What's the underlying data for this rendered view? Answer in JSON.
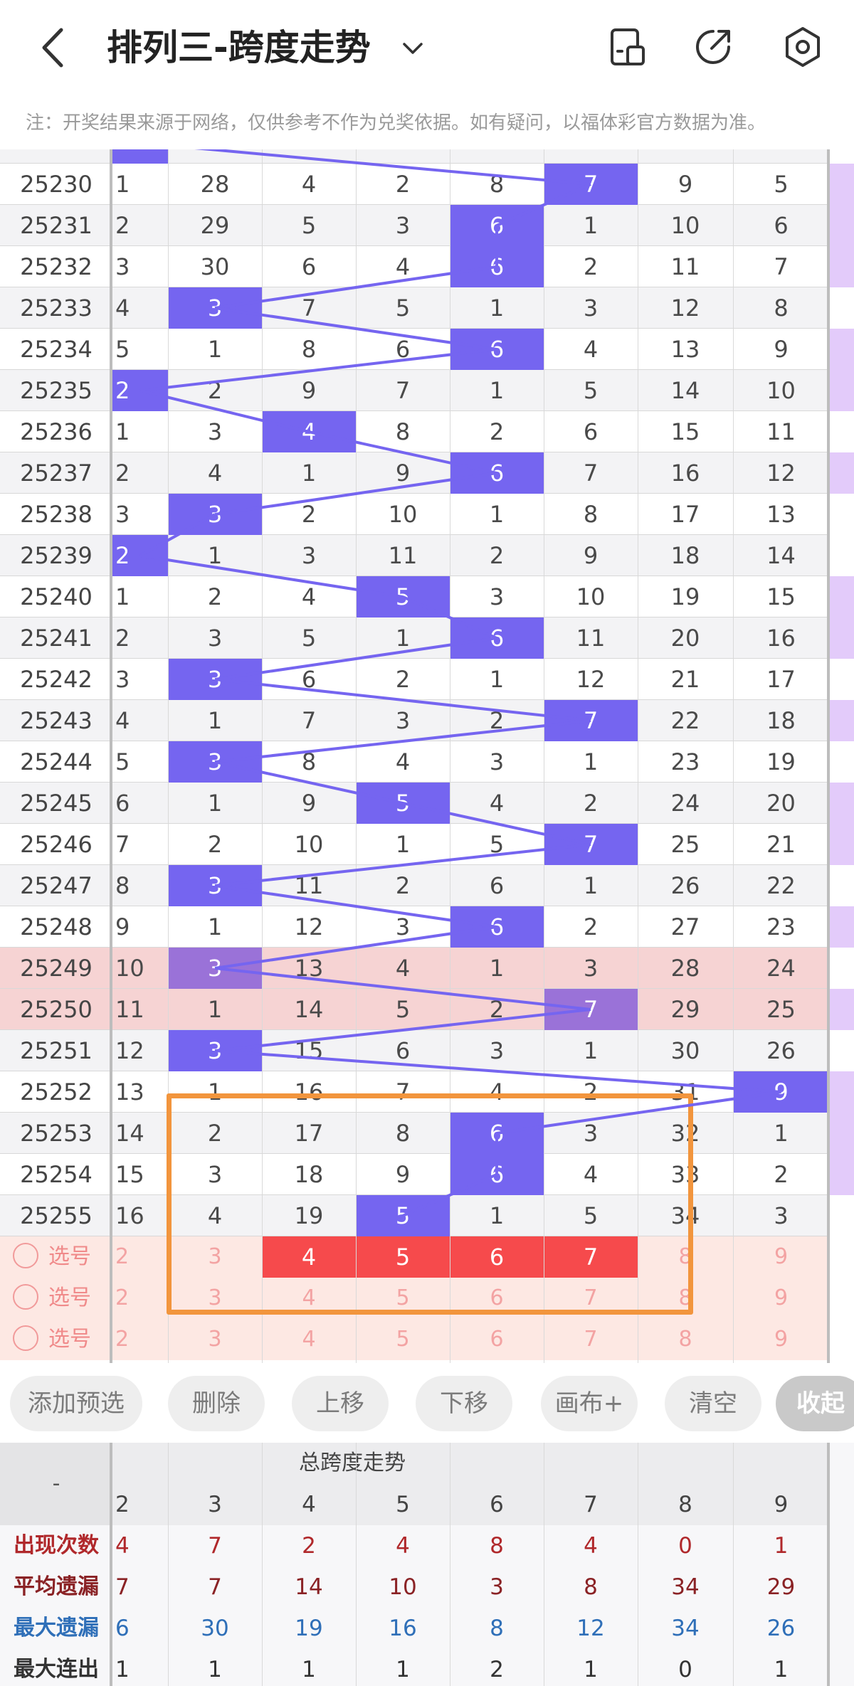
{
  "header": {
    "title": "排列三-跨度走势",
    "notice": "注：开奖结果来源于网络，仅供参考不作为兑奖依据。如有疑问，以福体彩官方数据为准。"
  },
  "grid": {
    "rows": [
      {
        "issue": "25230",
        "vals": [
          "1",
          "28",
          "4",
          "2",
          "8",
          "7",
          "9",
          "5"
        ],
        "hit": 5,
        "hl": false
      },
      {
        "issue": "25231",
        "vals": [
          "2",
          "29",
          "5",
          "3",
          "6",
          "1",
          "10",
          "6"
        ],
        "hit": 4,
        "hl": false
      },
      {
        "issue": "25232",
        "vals": [
          "3",
          "30",
          "6",
          "4",
          "6",
          "2",
          "11",
          "7"
        ],
        "hit": 4,
        "hl": false
      },
      {
        "issue": "25233",
        "vals": [
          "4",
          "3",
          "7",
          "5",
          "1",
          "3",
          "12",
          "8"
        ],
        "hit": 1,
        "hl": false
      },
      {
        "issue": "25234",
        "vals": [
          "5",
          "1",
          "8",
          "6",
          "6",
          "4",
          "13",
          "9"
        ],
        "hit": 4,
        "hl": false
      },
      {
        "issue": "25235",
        "vals": [
          "2",
          "2",
          "9",
          "7",
          "1",
          "5",
          "14",
          "10"
        ],
        "hit": 0,
        "hl": false
      },
      {
        "issue": "25236",
        "vals": [
          "1",
          "3",
          "4",
          "8",
          "2",
          "6",
          "15",
          "11"
        ],
        "hit": 2,
        "hl": false
      },
      {
        "issue": "25237",
        "vals": [
          "2",
          "4",
          "1",
          "9",
          "6",
          "7",
          "16",
          "12"
        ],
        "hit": 4,
        "hl": false
      },
      {
        "issue": "25238",
        "vals": [
          "3",
          "3",
          "2",
          "10",
          "1",
          "8",
          "17",
          "13"
        ],
        "hit": 1,
        "hl": false
      },
      {
        "issue": "25239",
        "vals": [
          "2",
          "1",
          "3",
          "11",
          "2",
          "9",
          "18",
          "14"
        ],
        "hit": 0,
        "hl": false
      },
      {
        "issue": "25240",
        "vals": [
          "1",
          "2",
          "4",
          "5",
          "3",
          "10",
          "19",
          "15"
        ],
        "hit": 3,
        "hl": false
      },
      {
        "issue": "25241",
        "vals": [
          "2",
          "3",
          "5",
          "1",
          "6",
          "11",
          "20",
          "16"
        ],
        "hit": 4,
        "hl": false
      },
      {
        "issue": "25242",
        "vals": [
          "3",
          "3",
          "6",
          "2",
          "1",
          "12",
          "21",
          "17"
        ],
        "hit": 1,
        "hl": false
      },
      {
        "issue": "25243",
        "vals": [
          "4",
          "1",
          "7",
          "3",
          "2",
          "7",
          "22",
          "18"
        ],
        "hit": 5,
        "hl": false
      },
      {
        "issue": "25244",
        "vals": [
          "5",
          "3",
          "8",
          "4",
          "3",
          "1",
          "23",
          "19"
        ],
        "hit": 1,
        "hl": false
      },
      {
        "issue": "25245",
        "vals": [
          "6",
          "1",
          "9",
          "5",
          "4",
          "2",
          "24",
          "20"
        ],
        "hit": 3,
        "hl": false
      },
      {
        "issue": "25246",
        "vals": [
          "7",
          "2",
          "10",
          "1",
          "5",
          "7",
          "25",
          "21"
        ],
        "hit": 5,
        "hl": false
      },
      {
        "issue": "25247",
        "vals": [
          "8",
          "3",
          "11",
          "2",
          "6",
          "1",
          "26",
          "22"
        ],
        "hit": 1,
        "hl": false
      },
      {
        "issue": "25248",
        "vals": [
          "9",
          "1",
          "12",
          "3",
          "6",
          "2",
          "27",
          "23"
        ],
        "hit": 4,
        "hl": false
      },
      {
        "issue": "25249",
        "vals": [
          "10",
          "3",
          "13",
          "4",
          "1",
          "3",
          "28",
          "24"
        ],
        "hit": 1,
        "hl": true
      },
      {
        "issue": "25250",
        "vals": [
          "11",
          "1",
          "14",
          "5",
          "2",
          "7",
          "29",
          "25"
        ],
        "hit": 5,
        "hl": true
      },
      {
        "issue": "25251",
        "vals": [
          "12",
          "3",
          "15",
          "6",
          "3",
          "1",
          "30",
          "26"
        ],
        "hit": 1,
        "hl": false
      },
      {
        "issue": "25252",
        "vals": [
          "13",
          "1",
          "16",
          "7",
          "4",
          "2",
          "31",
          "9"
        ],
        "hit": 7,
        "hl": false
      },
      {
        "issue": "25253",
        "vals": [
          "14",
          "2",
          "17",
          "8",
          "6",
          "3",
          "32",
          "1"
        ],
        "hit": 4,
        "hl": false
      },
      {
        "issue": "25254",
        "vals": [
          "15",
          "3",
          "18",
          "9",
          "6",
          "4",
          "33",
          "2"
        ],
        "hit": 4,
        "hl": false
      },
      {
        "issue": "25255",
        "vals": [
          "16",
          "4",
          "19",
          "5",
          "1",
          "5",
          "34",
          "3"
        ],
        "hit": 3,
        "hl": false
      }
    ],
    "side_on": [
      0,
      1,
      2,
      4,
      5,
      7,
      10,
      11,
      13,
      15,
      16,
      18,
      20,
      22,
      23,
      24
    ]
  },
  "pick_rows": [
    {
      "label": "选号",
      "vals": [
        "2",
        "3",
        "4",
        "5",
        "6",
        "7",
        "8",
        "9"
      ],
      "selected": [
        2,
        3,
        4,
        5
      ]
    },
    {
      "label": "选号",
      "vals": [
        "2",
        "3",
        "4",
        "5",
        "6",
        "7",
        "8",
        "9"
      ],
      "selected": []
    },
    {
      "label": "选号",
      "vals": [
        "2",
        "3",
        "4",
        "5",
        "6",
        "7",
        "8",
        "9"
      ],
      "selected": []
    }
  ],
  "toolbar": {
    "add_preselect": "添加预选",
    "delete": "删除",
    "move_up": "上移",
    "move_down": "下移",
    "canvas": "画布+",
    "clear": "清空",
    "collapse": "收起"
  },
  "stats": {
    "corner": "-",
    "group_title": "总跨度走势",
    "columns": [
      "2",
      "3",
      "4",
      "5",
      "6",
      "7",
      "8",
      "9"
    ],
    "rows": [
      {
        "label": "出现次数",
        "vals": [
          "4",
          "7",
          "2",
          "4",
          "8",
          "4",
          "0",
          "1"
        ],
        "color": "#b0282b"
      },
      {
        "label": "平均遗漏",
        "vals": [
          "7",
          "7",
          "14",
          "10",
          "3",
          "8",
          "34",
          "29"
        ],
        "color": "#8a2225"
      },
      {
        "label": "最大遗漏",
        "vals": [
          "6",
          "30",
          "19",
          "16",
          "8",
          "12",
          "34",
          "26"
        ],
        "color": "#2f6fb8"
      },
      {
        "label": "最大连出",
        "vals": [
          "1",
          "1",
          "1",
          "1",
          "2",
          "1",
          "0",
          "1"
        ],
        "color": "#333333"
      }
    ]
  },
  "colors": {
    "hit": "#7565f0",
    "trend_line": "#7565f0",
    "pick_selected": "#f64a4c",
    "highlight_row": "#f6d3d3",
    "orange_box": "#f2953d",
    "side_strip": "#e3cbfa"
  },
  "icons": {
    "back": "back-arrow-icon",
    "dropdown": "chevron-down-icon",
    "layout": "layout-icon",
    "share": "share-icon",
    "settings": "settings-icon"
  }
}
